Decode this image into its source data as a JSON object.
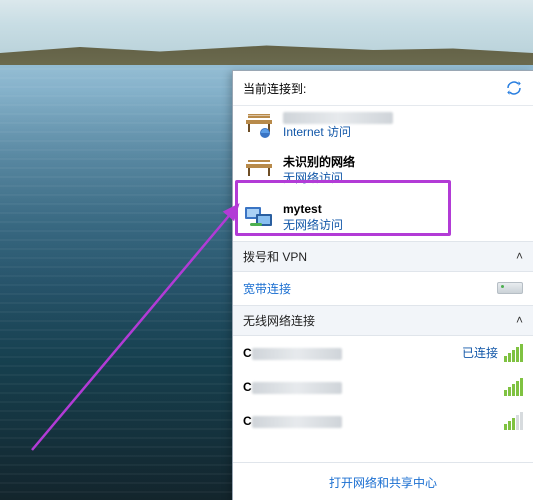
{
  "header": {
    "title": "当前连接到:"
  },
  "connections": [
    {
      "name_blurred": true,
      "status": "Internet 访问",
      "icon": "bench"
    },
    {
      "name": "未识别的网络",
      "status": "无网络访问",
      "icon": "bench"
    },
    {
      "name": "mytest",
      "status": "无网络访问",
      "icon": "monitor",
      "highlighted": true
    }
  ],
  "sections": {
    "dialup": {
      "label": "拨号和 VPN",
      "expanded": true,
      "link": "宽带连接"
    },
    "wireless": {
      "label": "无线网络连接",
      "expanded": true
    }
  },
  "wifi": [
    {
      "name_blurred": true,
      "status": "已连接",
      "signal": 5
    },
    {
      "name_blurred": true,
      "status": "",
      "signal": 5
    },
    {
      "name_blurred": true,
      "status": "",
      "signal": 3
    }
  ],
  "bottom_link": "打开网络和共享中心"
}
